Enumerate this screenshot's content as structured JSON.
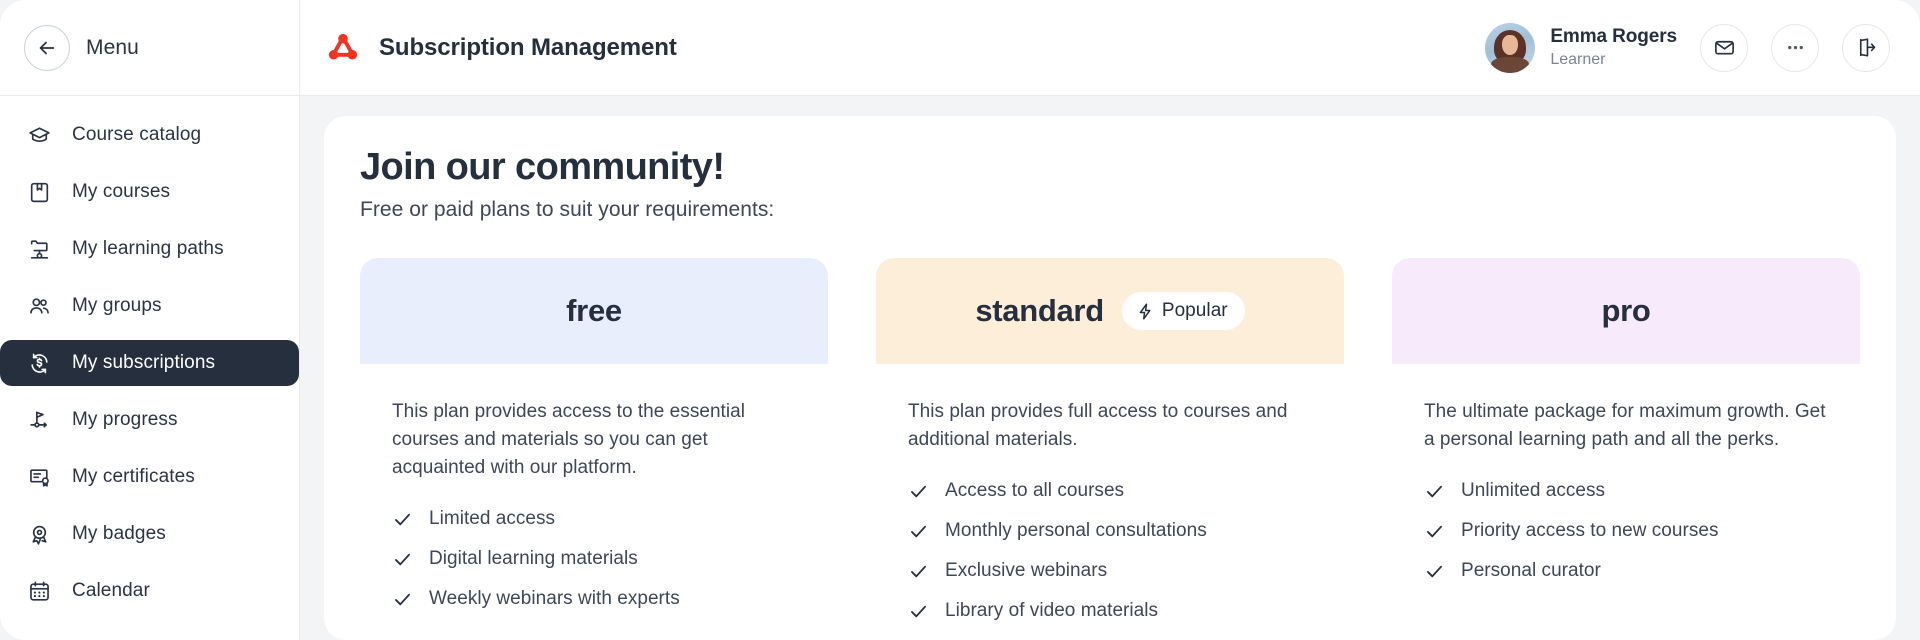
{
  "sidebar": {
    "menu_label": "Menu",
    "back_icon": "arrow-left-icon",
    "items": [
      {
        "label": "Course catalog",
        "icon": "graduation-cap-icon",
        "active": false
      },
      {
        "label": "My courses",
        "icon": "book-icon",
        "active": false
      },
      {
        "label": "My learning paths",
        "icon": "learning-path-icon",
        "active": false
      },
      {
        "label": "My groups",
        "icon": "people-icon",
        "active": false
      },
      {
        "label": "My subscriptions",
        "icon": "subscription-icon",
        "active": true
      },
      {
        "label": "My progress",
        "icon": "flag-progress-icon",
        "active": false
      },
      {
        "label": "My certificates",
        "icon": "certificate-icon",
        "active": false
      },
      {
        "label": "My badges",
        "icon": "badge-icon",
        "active": false
      },
      {
        "label": "Calendar",
        "icon": "calendar-icon",
        "active": false
      }
    ]
  },
  "header": {
    "logo_icon": "triangle-logo-icon",
    "logo_color": "#f5311f",
    "title": "Subscription Management",
    "user": {
      "name": "Emma Rogers",
      "role": "Learner",
      "avatar_icon": "user-avatar"
    },
    "actions": [
      {
        "name": "mail-icon",
        "label": ""
      },
      {
        "name": "more-icon",
        "label": ""
      },
      {
        "name": "logout-icon",
        "label": ""
      }
    ]
  },
  "main": {
    "title": "Join our community!",
    "subtitle": "Free or paid plans to suit your requirements:",
    "plans": [
      {
        "name": "free",
        "head_color": "#e8eefb",
        "badge": null,
        "description": "This plan provides access to the essential courses and materials so you can get acquainted with our platform.",
        "features": [
          "Limited access",
          "Digital learning materials",
          "Weekly webinars with experts"
        ]
      },
      {
        "name": "standard",
        "head_color": "#fdeed9",
        "badge": {
          "label": "Popular",
          "icon": "lightning-bolt-icon"
        },
        "description": "This plan provides full access to courses and additional materials.",
        "features": [
          "Access to all courses",
          "Monthly personal consultations",
          "Exclusive webinars",
          "Library of video materials"
        ]
      },
      {
        "name": "pro",
        "head_color": "#f7ebfb",
        "badge": null,
        "description": "The ultimate package for maximum growth. Get a personal learning path and all the perks.",
        "features": [
          "Unlimited access",
          "Priority access to new courses",
          "Personal curator"
        ]
      }
    ]
  },
  "colors": {
    "accent": "#f5311f",
    "sidebar_active_bg": "#252f3e",
    "text_primary": "#252f3e",
    "text_secondary": "#3e4758",
    "muted": "#7a8495",
    "page_bg": "#f3f4f6"
  }
}
